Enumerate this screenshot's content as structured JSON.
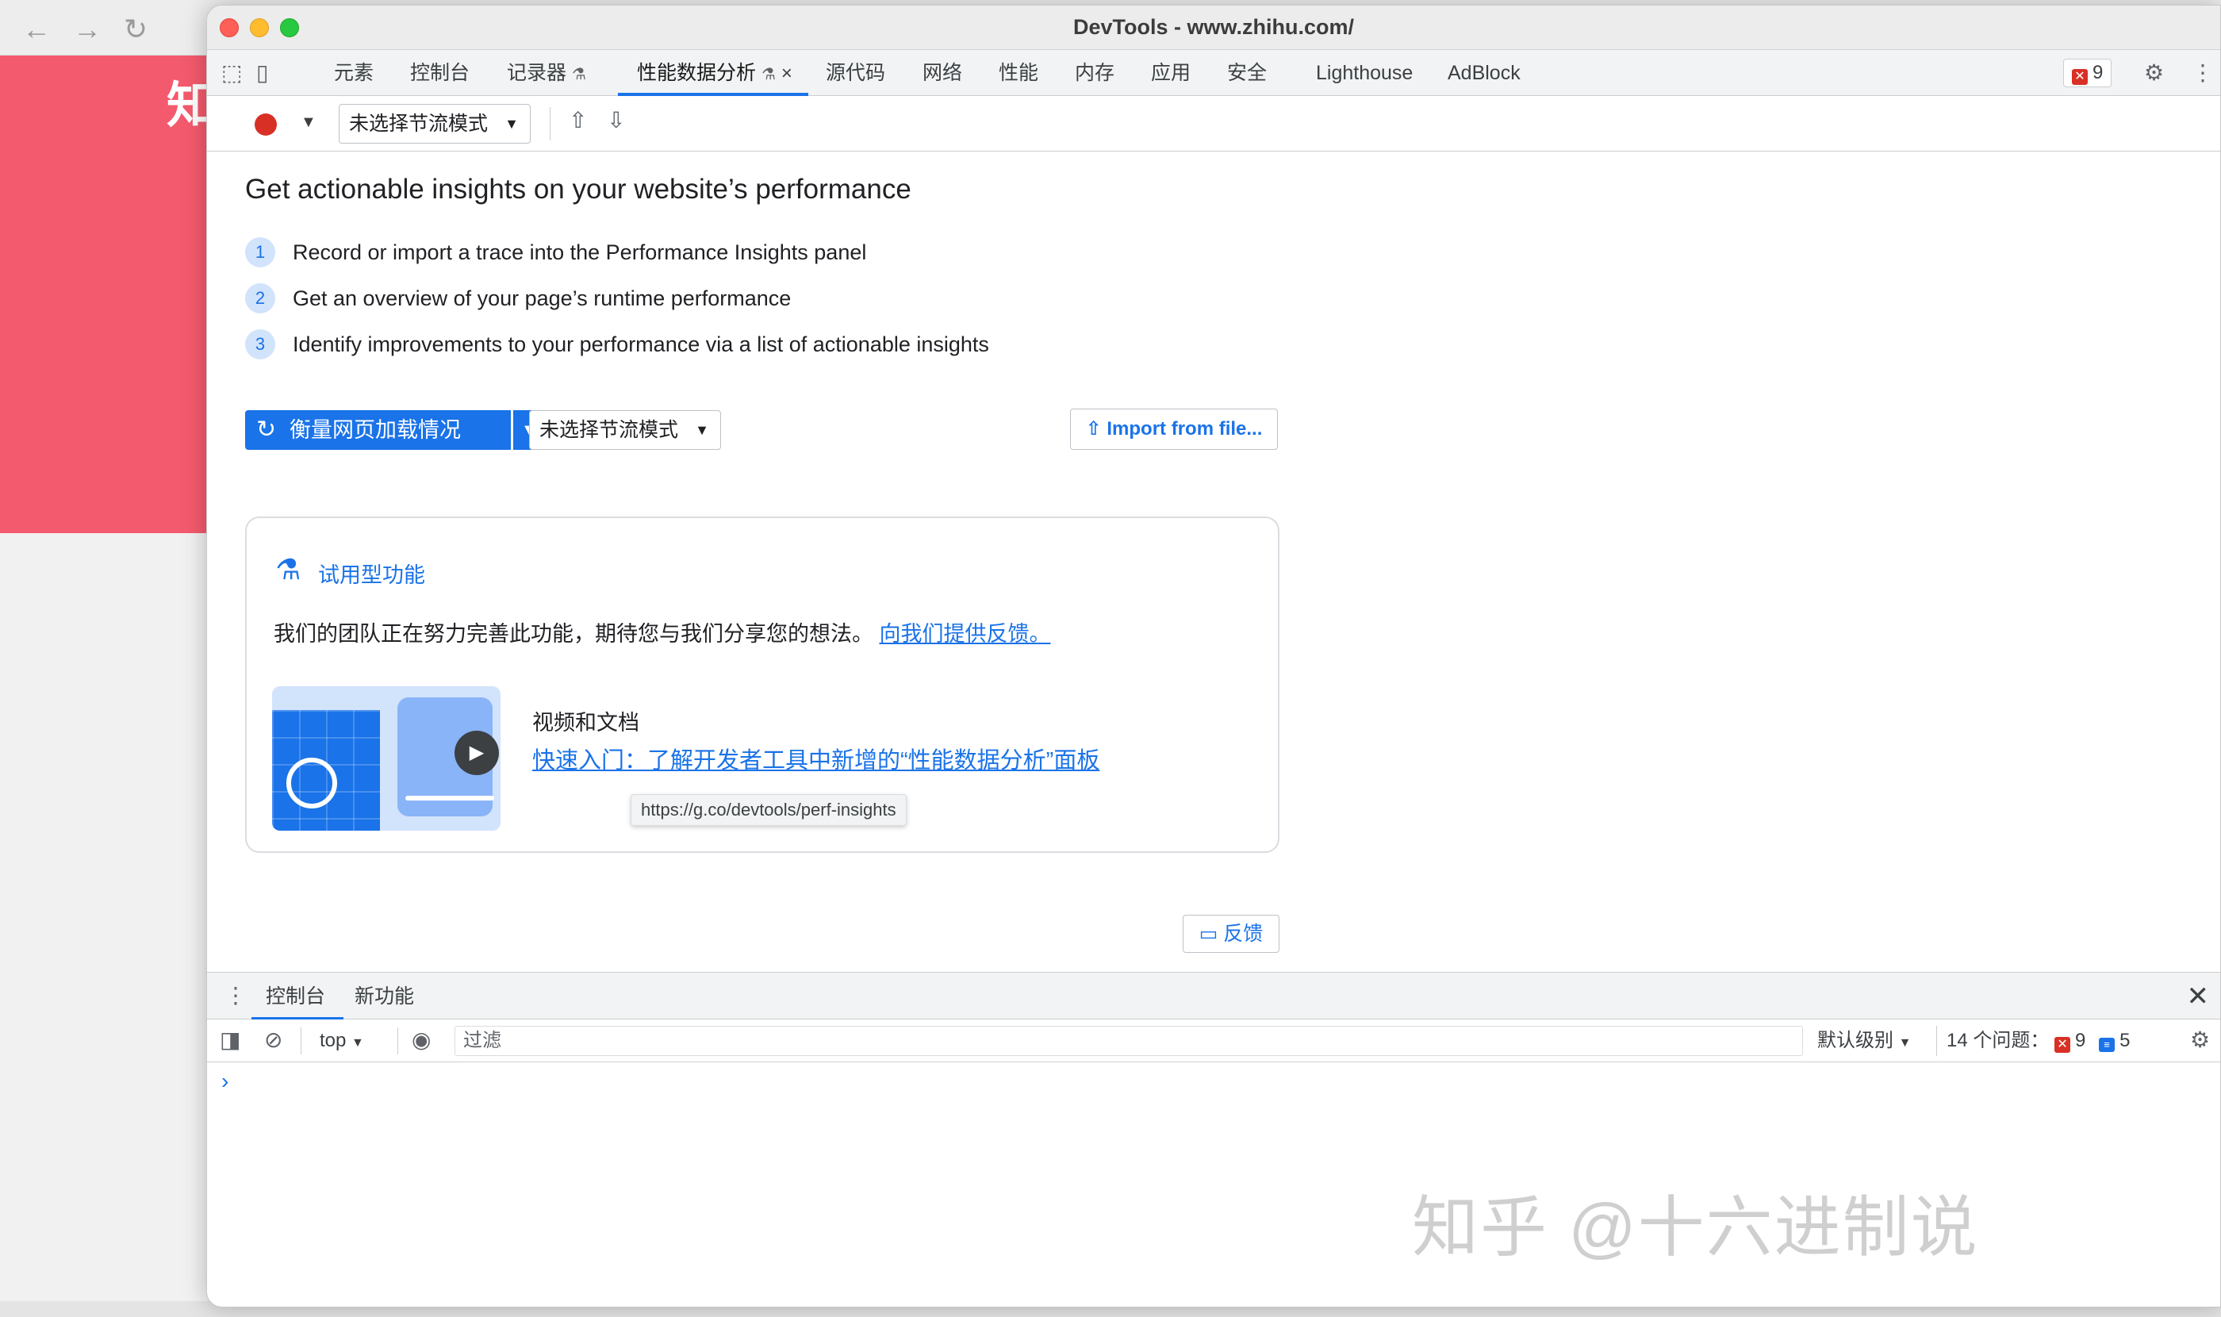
{
  "background_browser": {
    "nav_back": "←",
    "nav_forward": "→",
    "reload": "↻",
    "page_glyph": "知"
  },
  "window": {
    "title": "DevTools - www.zhihu.com/"
  },
  "tabs": [
    {
      "label": "元素"
    },
    {
      "label": "控制台"
    },
    {
      "label": "记录器"
    },
    {
      "label": "性能数据分析"
    },
    {
      "label": "源代码"
    },
    {
      "label": "网络"
    },
    {
      "label": "性能"
    },
    {
      "label": "内存"
    },
    {
      "label": "应用"
    },
    {
      "label": "安全"
    },
    {
      "label": "Lighthouse"
    },
    {
      "label": "AdBlock"
    }
  ],
  "tab_icons": {
    "recorder_flask": "⚗",
    "perf_flask": "⚗",
    "perf_close": "×"
  },
  "error_badge": {
    "count": "9"
  },
  "toolbar": {
    "throttle_select": "未选择节流模式"
  },
  "content": {
    "heading": "Get actionable insights on your website’s performance",
    "steps": [
      {
        "num": "1",
        "text": "Record or import a trace into the Performance Insights panel"
      },
      {
        "num": "2",
        "text": "Get an overview of your page’s runtime performance"
      },
      {
        "num": "3",
        "text": "Identify improvements to your performance via a list of actionable insights"
      }
    ],
    "measure_button": "衡量网页加载情况",
    "throttle_select": "未选择节流模式",
    "import_button": "Import from file..."
  },
  "card": {
    "title": "试用型功能",
    "description": "我们的团队正在努力完善此功能，期待您与我们分享您的想法。",
    "feedback_link": "向我们提供反馈。",
    "video_label": "视频和文档",
    "video_link": "快速入门：了解开发者工具中新增的“性能数据分析”面板",
    "tooltip": "https://g.co/devtools/perf-insights"
  },
  "feedback_button": "反馈",
  "drawer": {
    "tabs": [
      {
        "label": "控制台"
      },
      {
        "label": "新功能"
      }
    ],
    "context": "top",
    "filter_placeholder": "过滤",
    "level": "默认级别",
    "issues_label": "14 个问题：",
    "issues_errors": "9",
    "issues_info": "5",
    "prompt": "›"
  },
  "watermark": "知乎 @十六进制说",
  "colors": {
    "accent": "#1a73e8",
    "record": "#d93025",
    "bg_pink": "#f45a6d"
  }
}
